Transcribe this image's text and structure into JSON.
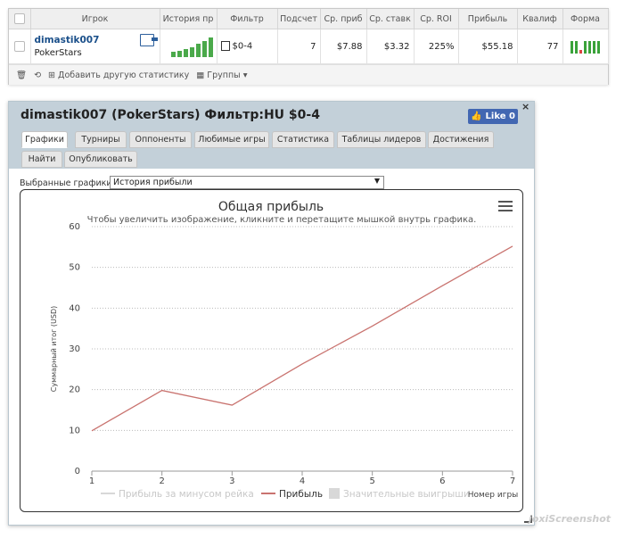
{
  "top_table": {
    "columns": [
      "Игрок",
      "История пр",
      "Фильтр",
      "Подсчет",
      "Ср. приб",
      "Ср. ставк",
      "Ср. ROI",
      "Прибыль",
      "Квалиф",
      "Форма"
    ],
    "row": {
      "player": "dimastik007",
      "network": "PokerStars",
      "filter": "$0-4",
      "count": "7",
      "avg_profit": "$7.88",
      "avg_stake": "$3.32",
      "avg_roi": "225%",
      "profit": "$55.18",
      "qualification": "77",
      "remove": "x"
    },
    "spark_values": [
      3,
      4,
      5,
      6,
      8,
      10,
      12
    ],
    "form_results": [
      "w",
      "w",
      "l",
      "w",
      "w",
      "w",
      "w"
    ],
    "toolbar": {
      "add_stats": "Добавить другую статистику",
      "groups": "Группы"
    }
  },
  "popup": {
    "title": "dimastik007 (PokerStars) Фильтр:HU $0-4",
    "like_label": "Like 0",
    "close": "×",
    "tabs": [
      "Графики",
      "Турниры",
      "Оппоненты",
      "Любимые игры",
      "Статистика",
      "Таблицы лидеров",
      "Достижения",
      "Найти",
      "Опубликовать"
    ],
    "active_tab": 0,
    "chart_select_label": "Выбранные графики:",
    "chart_select_value": "История прибыли"
  },
  "chart_data": {
    "type": "line",
    "title": "Общая прибыль",
    "subtitle": "Чтобы увеличить изображение, кликните и перетащите мышкой внутрь графика.",
    "xlabel": "Номер игры",
    "ylabel": "Суммарный итог (USD)",
    "x": [
      1,
      2,
      3,
      4,
      5,
      6,
      7
    ],
    "ylim": [
      0,
      60
    ],
    "yticks": [
      0,
      10,
      20,
      30,
      40,
      50,
      60
    ],
    "grid": true,
    "legend_position": "bottom",
    "series": [
      {
        "name": "Прибыль за минусом рейка",
        "values": [],
        "color": "#d8d8d8"
      },
      {
        "name": "Прибыль",
        "values": [
          9.9,
          19.8,
          16.2,
          26.3,
          35.6,
          45.5,
          55.2
        ],
        "color": "#c9736f"
      },
      {
        "name": "Значительные выигрыши",
        "values": [],
        "color": "#d8d8d8"
      }
    ]
  },
  "watermark": "joxiScreenshot"
}
